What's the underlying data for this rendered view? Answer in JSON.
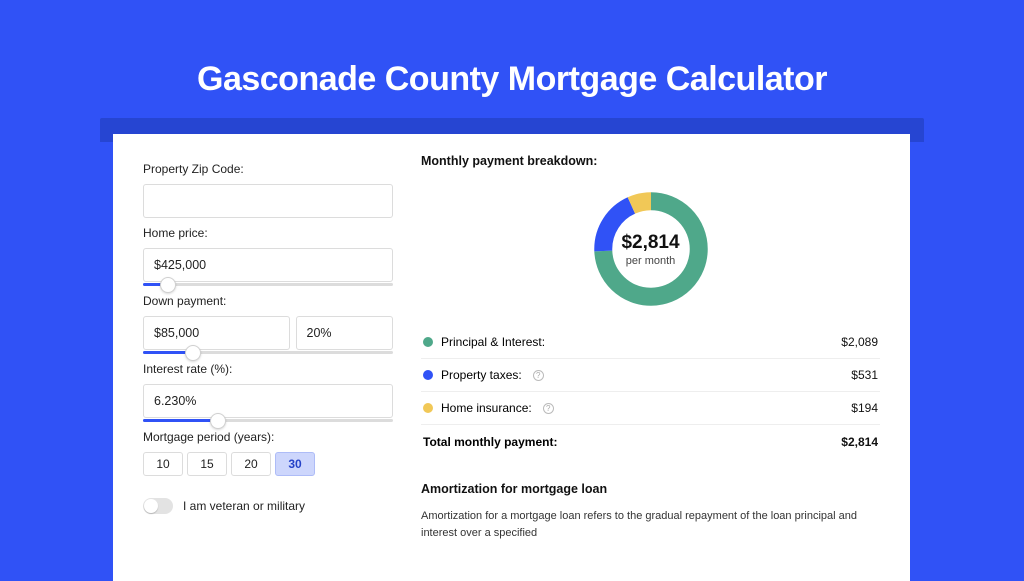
{
  "title": "Gasconade County Mortgage Calculator",
  "colors": {
    "principal": "#4fa88a",
    "taxes": "#3052f6",
    "insurance": "#f1c857"
  },
  "form": {
    "zip": {
      "label": "Property Zip Code:",
      "value": ""
    },
    "homePrice": {
      "label": "Home price:",
      "value": "$425,000",
      "sliderPct": 10
    },
    "downPayment": {
      "label": "Down payment:",
      "amount": "$85,000",
      "pct": "20%",
      "sliderPct": 20
    },
    "interestRate": {
      "label": "Interest rate (%):",
      "value": "6.230%",
      "sliderPct": 30
    },
    "period": {
      "label": "Mortgage period (years):",
      "options": [
        "10",
        "15",
        "20",
        "30"
      ],
      "selected": "30"
    },
    "veteran": {
      "label": "I am veteran or military",
      "checked": false
    }
  },
  "breakdown": {
    "title": "Monthly payment breakdown:",
    "totalAmount": "$2,814",
    "perMonth": "per month",
    "items": [
      {
        "label": "Principal & Interest:",
        "value": "$2,089",
        "colorKey": "principal",
        "help": false
      },
      {
        "label": "Property taxes:",
        "value": "$531",
        "colorKey": "taxes",
        "help": true
      },
      {
        "label": "Home insurance:",
        "value": "$194",
        "colorKey": "insurance",
        "help": true
      }
    ],
    "totalLabel": "Total monthly payment:",
    "totalValue": "$2,814"
  },
  "amortization": {
    "title": "Amortization for mortgage loan",
    "body": "Amortization for a mortgage loan refers to the gradual repayment of the loan principal and interest over a specified"
  },
  "chart_data": {
    "type": "pie",
    "title": "Monthly payment breakdown",
    "categories": [
      "Principal & Interest",
      "Property taxes",
      "Home insurance"
    ],
    "values": [
      2089,
      531,
      194
    ],
    "total": 2814
  }
}
